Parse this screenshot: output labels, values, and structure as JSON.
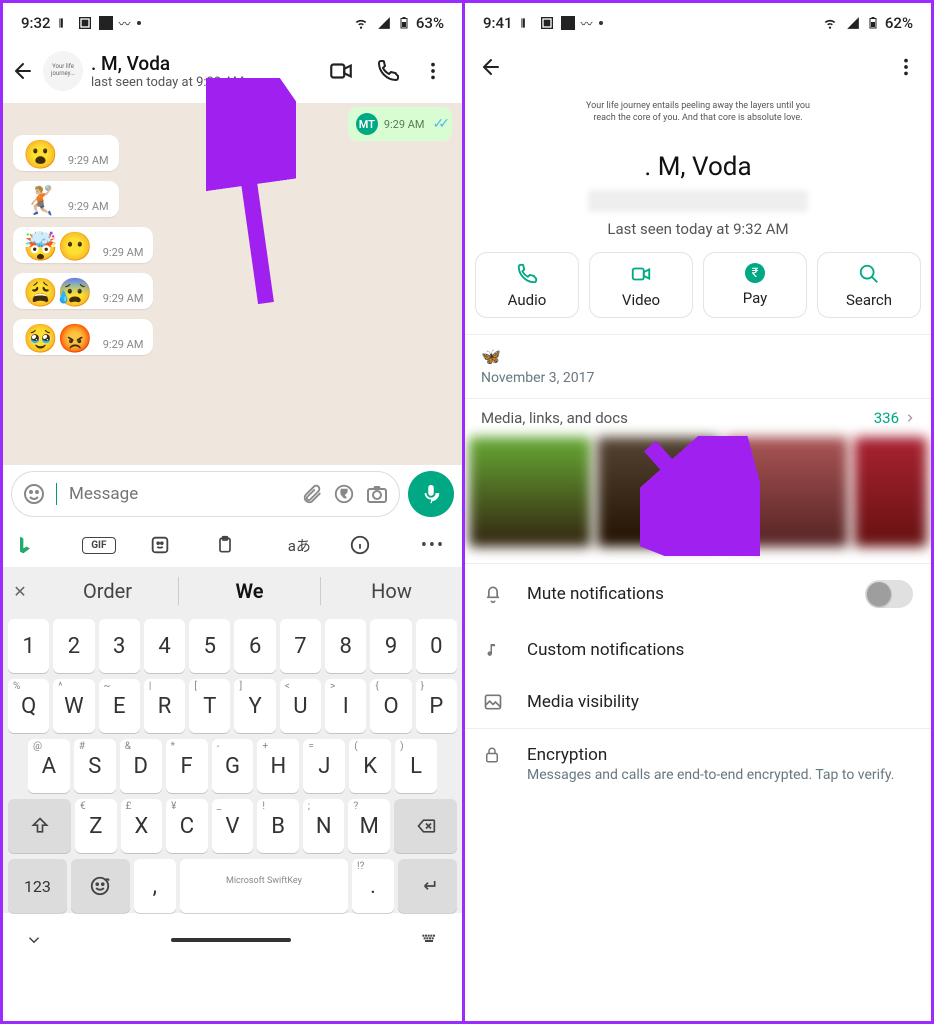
{
  "left": {
    "status": {
      "time": "9:32",
      "battery": "63%"
    },
    "chat": {
      "name": ". M, Voda",
      "subtitle": "last seen today at 9:32 AM",
      "avatar_text": "Your life journey...",
      "outgoing": {
        "avatar": "MT",
        "time": "9:29 AM"
      },
      "bubbles": [
        {
          "emoji": "😮",
          "time": "9:29 AM"
        },
        {
          "emoji": "🤾🏼",
          "time": "9:29 AM"
        },
        {
          "emoji": "🤯😶",
          "time": "9:29 AM"
        },
        {
          "emoji": "😩😰",
          "time": "9:29 AM"
        },
        {
          "emoji": "🥹😡",
          "time": "9:29 AM"
        }
      ],
      "placeholder": "Message"
    },
    "suggest": [
      "Order",
      "We",
      "How"
    ],
    "keyboard": {
      "row1": [
        "1",
        "2",
        "3",
        "4",
        "5",
        "6",
        "7",
        "8",
        "9",
        "0"
      ],
      "row2": [
        [
          "Q",
          "%"
        ],
        [
          "W",
          "^"
        ],
        [
          "E",
          "~"
        ],
        [
          "R",
          "|"
        ],
        [
          "T",
          "["
        ],
        [
          "Y",
          "]"
        ],
        [
          "U",
          "<"
        ],
        [
          "I",
          ">"
        ],
        [
          "O",
          "{"
        ],
        [
          "P",
          "}"
        ]
      ],
      "row3": [
        [
          "A",
          "@"
        ],
        [
          "S",
          "#"
        ],
        [
          "D",
          "&"
        ],
        [
          "F",
          "*"
        ],
        [
          "G",
          "-"
        ],
        [
          "H",
          "+"
        ],
        [
          "J",
          "="
        ],
        [
          "K",
          "("
        ],
        [
          "L",
          ")"
        ]
      ],
      "row4": [
        [
          "Z",
          "€"
        ],
        [
          "X",
          "£"
        ],
        [
          "C",
          "¥"
        ],
        [
          "V",
          "_"
        ],
        [
          "B",
          "!"
        ],
        [
          "N",
          ";"
        ],
        [
          "M",
          "?"
        ]
      ],
      "n123": "123",
      "credit": "Microsoft SwiftKey"
    }
  },
  "right": {
    "status": {
      "time": "9:41",
      "battery": "62%"
    },
    "avatar_quote": "Your life journey entails peeling away the layers until you reach the core of you. And that core is absolute love.",
    "name": ". M, Voda",
    "seen": "Last seen today at 9:32 AM",
    "actions": {
      "audio": "Audio",
      "video": "Video",
      "pay": "Pay",
      "search": "Search"
    },
    "about": {
      "emoji": "🦋",
      "date": "November 3, 2017"
    },
    "media": {
      "label": "Media, links, and docs",
      "count": "336"
    },
    "opts": {
      "mute": "Mute notifications",
      "custom": "Custom notifications",
      "vis": "Media visibility",
      "enc": "Encryption",
      "enc_sub": "Messages and calls are end-to-end encrypted. Tap to verify."
    }
  }
}
